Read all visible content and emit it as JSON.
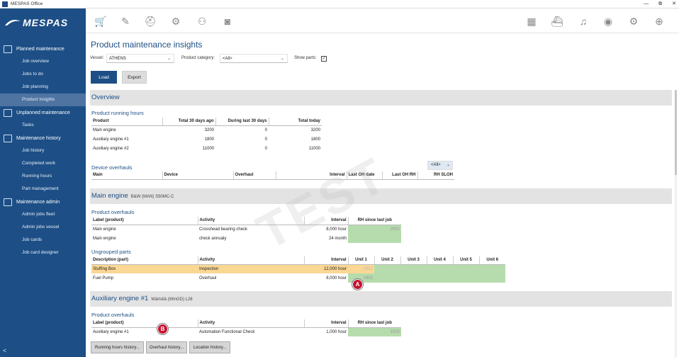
{
  "window": {
    "title": "MESPAS Office",
    "minimize": "—",
    "restore": "⧉",
    "close": "✕"
  },
  "brand": {
    "name": "MESPAS"
  },
  "sidebar": {
    "groups": [
      {
        "label": "Planned maintenance",
        "icon": "calendar-icon",
        "items": [
          "Job overview",
          "Jobs to do",
          "Job planning",
          "Product insights"
        ]
      },
      {
        "label": "Unplanned maintenance",
        "icon": "wrench-person-icon",
        "items": [
          "Tasks"
        ]
      },
      {
        "label": "Maintenance history",
        "icon": "history-book-icon",
        "items": [
          "Job history",
          "Completed work",
          "Running hours",
          "Part management"
        ]
      },
      {
        "label": "Maintenance admin",
        "icon": "admin-gear-icon",
        "items": [
          "Admin jobs fleet",
          "Admin jobs vessel",
          "Job cards",
          "Job card designer"
        ]
      }
    ],
    "active_item": "Product insights"
  },
  "topbar": {
    "left_icons": [
      "cart-icon",
      "tools-icon",
      "helmet-icon",
      "gear-person-icon",
      "people-icon",
      "camera-icon"
    ],
    "right_icons": [
      "table-grid-icon",
      "ship-icon",
      "bell-icon",
      "user-icon",
      "settings-icon",
      "plus-icon"
    ]
  },
  "page": {
    "title": "Product maintenance insights",
    "vessel_label": "Vessel:",
    "vessel_value": "ATHENS",
    "category_label": "Product category:",
    "category_value": "<All>",
    "show_parts_label": "Show parts:",
    "show_parts_checked": "✓",
    "load_label": "Load",
    "export_label": "Export",
    "watermark": "TEST"
  },
  "overview": {
    "heading": "Overview",
    "running_hours_title": "Product running hours",
    "running_hours_headers": [
      "Product",
      "Total 30 days ago",
      "During last 30 days",
      "Total today"
    ],
    "running_hours_rows": [
      [
        "Main engine",
        "3200",
        "0",
        "3200"
      ],
      [
        "Auxiliary engine #1",
        "1800",
        "0",
        "1800"
      ],
      [
        "Auxiliary engine #2",
        "11000",
        "0",
        "11000"
      ]
    ],
    "device_overhauls_title": "Device overhauls",
    "device_filter": "<All>",
    "device_headers": [
      "Main",
      "Device",
      "Overhaul",
      "Interval",
      "Last OH date",
      "Last OH RH",
      "RH SLOH"
    ]
  },
  "main_engine": {
    "heading": "Main engine",
    "sub": "B&W (MAN)  S50MC-C",
    "overhauls_title": "Product overhauls",
    "overhaul_headers": [
      "Label (product)",
      "Activity",
      "Interval",
      "RH since last job"
    ],
    "overhaul_rows": [
      [
        "Main engine",
        "Crosshead bearing check",
        "8,000 hour",
        "2952"
      ],
      [
        "Main engine",
        "check annualy",
        "24 month",
        ""
      ]
    ],
    "ungrouped_title": "Ungrouped parts",
    "parts_headers": [
      "Description (part)",
      "Activity",
      "Interval",
      "Unit 1",
      "Unit 2",
      "Unit 3",
      "Unit 4",
      "Unit 5",
      "Unit 6"
    ],
    "parts_rows": [
      [
        "Stuffing Box",
        "Inspection",
        "12,000 hour",
        "2952",
        "",
        "",
        "",
        "",
        ""
      ],
      [
        "Fuel Pump",
        "Overhaul",
        "8,000 hour",
        "2952",
        "",
        "",
        "",
        "",
        ""
      ]
    ]
  },
  "aux_engine": {
    "heading": "Auxiliary engine #1",
    "sub": "Wärtsilä   (WinGD)  L28",
    "overhauls_title": "Product overhauls",
    "overhaul_headers": [
      "Label (product)",
      "Activity",
      "Interval",
      "RH since last job"
    ],
    "overhaul_rows": [
      [
        "Auxiliary engine #1",
        "Automation Functional Check",
        "1,000 hour",
        "1502"
      ]
    ]
  },
  "markers": {
    "a": "A",
    "b": "B"
  },
  "bottom_buttons": [
    "Running hours history...",
    "Overhaul history...",
    "Location history..."
  ],
  "colors": {
    "brand": "#1d4f86",
    "highlight_row": "#fbd794",
    "due_ok": "#b6dcae"
  }
}
